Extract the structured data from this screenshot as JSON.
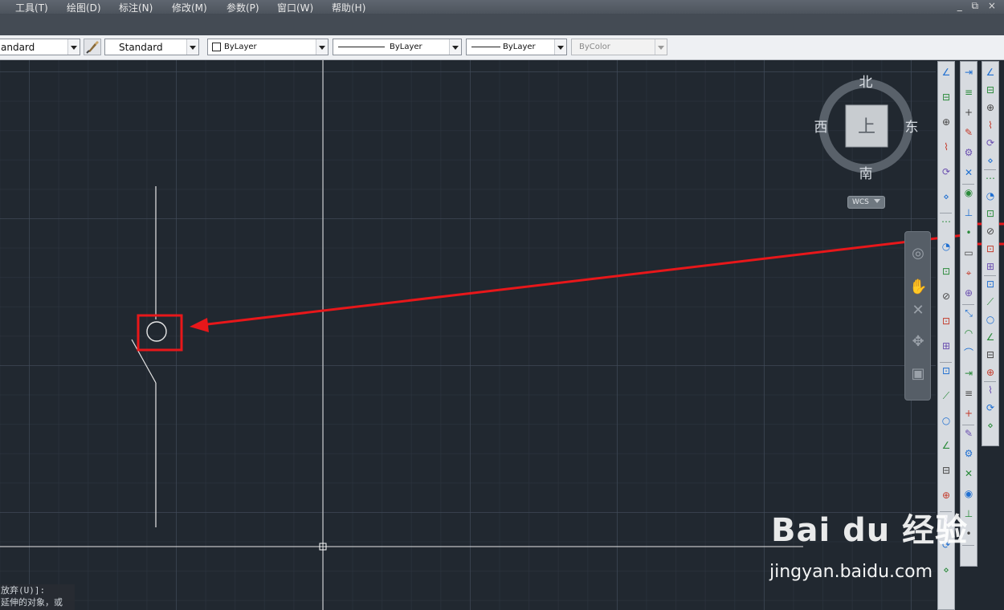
{
  "menu": {
    "items": [
      "工具(T)",
      "绘图(D)",
      "标注(N)",
      "修改(M)",
      "参数(P)",
      "窗口(W)",
      "帮助(H)"
    ],
    "window_controls": "_ ⧉ ×"
  },
  "properties_toolbar": {
    "text_style": "andard",
    "dim_style": "Standard",
    "layer": "ByLayer",
    "linetype": "ByLayer",
    "lineweight": "ByLayer",
    "color": "ByColor"
  },
  "viewcube": {
    "north": "北",
    "south": "南",
    "east": "东",
    "west": "西",
    "face": "上",
    "ucs_label": "WCS"
  },
  "command_line": {
    "line1": "放弃(U)]:",
    "line2": "延伸的对象，或"
  },
  "toolbar_icons": {
    "dimension_column": [
      "dim-linear-icon",
      "dim-aligned-icon",
      "dim-arc-icon",
      "dim-ordinate-icon",
      "dim-radius-icon",
      "dim-jogged-icon",
      "dim-diameter-icon",
      "dim-angular-icon",
      "quick-dim-icon",
      "dim-baseline-icon",
      "dim-continue-icon",
      "dim-space-icon",
      "dim-break-icon",
      "tolerance-icon",
      "center-mark-icon",
      "inspect-icon",
      "jogged-linear-icon",
      "dim-edit-icon",
      "dim-text-edit-icon",
      "dim-update-icon",
      "dim-style-icon"
    ],
    "snap_column": [
      "snap-endpoint-icon",
      "snap-midpoint-icon",
      "snap-intersection-icon",
      "snap-apparent-icon",
      "snap-extension-icon",
      "snap-center-icon",
      "snap-quadrant-icon",
      "snap-tangent-icon",
      "snap-perpendicular-icon",
      "snap-parallel-icon",
      "snap-insert-icon",
      "snap-node-icon",
      "snap-nearest-icon",
      "snap-none-icon",
      "osnap-settings-icon",
      "zoom-window-icon",
      "zoom-dynamic-icon",
      "zoom-scale-icon",
      "zoom-center-icon",
      "zoom-object-icon",
      "zoom-in-icon",
      "zoom-out-icon",
      "zoom-all-icon",
      "zoom-extents-icon"
    ],
    "modify_column": [
      "erase-icon",
      "copy-icon",
      "mirror-icon",
      "offset-icon",
      "array-icon",
      "move-icon",
      "rotate-icon",
      "scale-icon",
      "stretch-icon",
      "trim-icon",
      "extend-icon",
      "break-at-point-icon",
      "break-icon",
      "join-icon",
      "chamfer-icon",
      "fillet-icon",
      "blend-icon",
      "explode-icon",
      "array-rect-icon",
      "edit-spline-icon",
      "edit-polyline-icon"
    ]
  },
  "watermark": {
    "brand": "Bai du 经验",
    "url": "jingyan.baidu.com"
  },
  "colors": {
    "canvas_background": "#212830",
    "annotation_red": "#e8171a",
    "drawing_lines": "#e6e6e6"
  }
}
